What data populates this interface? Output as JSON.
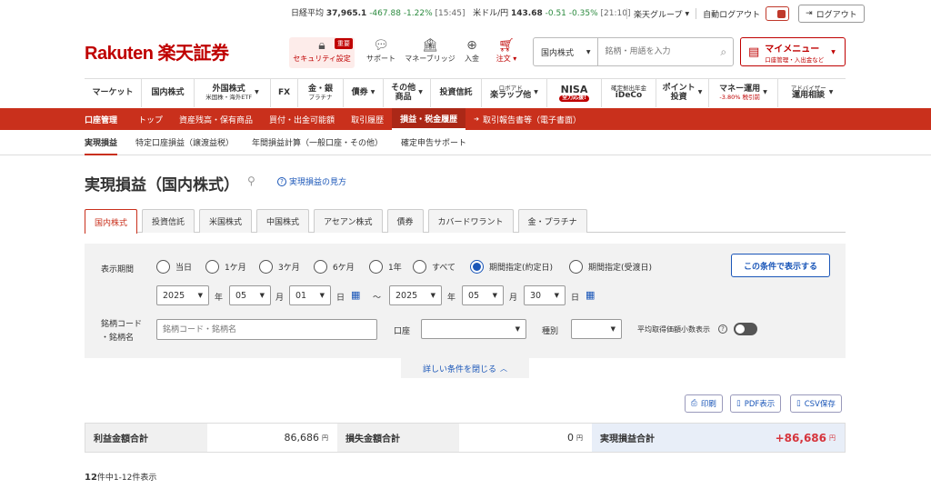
{
  "ticker": {
    "nikkei_label": "日経平均",
    "nikkei_value": "37,965.1",
    "nikkei_change": "-467.88",
    "nikkei_pct": "-1.22%",
    "nikkei_time": "[15:45]",
    "usdjpy_label": "米ドル/円",
    "usdjpy_value": "143.68",
    "usdjpy_change": "-0.51",
    "usdjpy_pct": "-0.35%",
    "usdjpy_time": "[21:10]"
  },
  "top": {
    "group_label": "楽天グループ",
    "auto_logout_label": "自動ログアウト",
    "logout_label": "ログアウト"
  },
  "logo_text": "Rakuten 楽天証券",
  "header_icons": {
    "security_label": "セキュリティ設定",
    "security_badge": "重要",
    "support_label": "サポート",
    "bridge_label": "マネーブリッジ",
    "deposit_label": "入金",
    "order_label": "注文"
  },
  "search": {
    "market_value": "国内株式",
    "placeholder": "銘柄・用語を入力"
  },
  "mymenu": {
    "title": "マイメニュー",
    "subtitle": "口座管理・入出金など"
  },
  "mainnav": [
    {
      "label": "マーケット",
      "sub": ""
    },
    {
      "label": "国内株式",
      "sub": ""
    },
    {
      "label": "外国株式",
      "sub": "米国株・海外ETF"
    },
    {
      "label": "FX",
      "sub": ""
    },
    {
      "label": "金・銀",
      "sub": "プラチナ"
    },
    {
      "label": "債券",
      "sub": ""
    },
    {
      "label": "その他",
      "sub": "商品"
    },
    {
      "label": "投資信託",
      "sub": ""
    },
    {
      "label": "ロボアド",
      "sub": "楽ラップ他"
    },
    {
      "label": "NISA",
      "sub": "全力応援!"
    },
    {
      "label": "確定拠出年金",
      "sub": "iDeCo"
    },
    {
      "label": "ポイント",
      "sub": "投資"
    },
    {
      "label": "マネー運用",
      "sub": "-3.80% 税引前"
    },
    {
      "label": "アドバイザー",
      "sub": "運用相談"
    }
  ],
  "redbar": {
    "title": "口座管理",
    "items": [
      "トップ",
      "資産残高・保有商品",
      "買付・出金可能額",
      "取引履歴",
      "損益・税金履歴",
      "取引報告書等（電子書面）"
    ]
  },
  "subnav": [
    "実現損益",
    "特定口座損益（譲渡益税）",
    "年間損益計算（一般口座・その他）",
    "確定申告サポート"
  ],
  "page_title": "実現損益（国内株式）",
  "help_link": "実現損益の見方",
  "tabs": [
    "国内株式",
    "投資信託",
    "米国株式",
    "中国株式",
    "アセアン株式",
    "債券",
    "カバードワラント",
    "金・プラチナ"
  ],
  "filter": {
    "period_label": "表示期間",
    "periods": [
      "当日",
      "1ケ月",
      "3ケ月",
      "6ケ月",
      "1年",
      "すべて",
      "期間指定(約定日)",
      "期間指定(受渡日)"
    ],
    "selected_period": "期間指定(約定日)",
    "from": {
      "year": "2025",
      "month": "05",
      "day": "01"
    },
    "to": {
      "year": "2025",
      "month": "05",
      "day": "30"
    },
    "year_unit": "年",
    "month_unit": "月",
    "day_unit": "日",
    "tilde": "〜",
    "code_label_1": "銘柄コード",
    "code_label_2": "・銘柄名",
    "code_placeholder": "銘柄コード・銘柄名",
    "account_label": "口座",
    "type_label": "種別",
    "decimal_label": "平均取得価額小数表示",
    "submit_label": "この条件で表示する",
    "collapse_label": "詳しい条件を閉じる"
  },
  "output_buttons": {
    "print": "印刷",
    "pdf": "PDF表示",
    "csv": "CSV保存"
  },
  "summary": {
    "profit_label": "利益金額合計",
    "profit_value": "86,686",
    "loss_label": "損失金額合計",
    "loss_value": "0",
    "realized_label": "実現損益合計",
    "realized_value": "+86,686",
    "yen": "円"
  },
  "count": {
    "total": "12",
    "text": "件中1-12件表示"
  }
}
